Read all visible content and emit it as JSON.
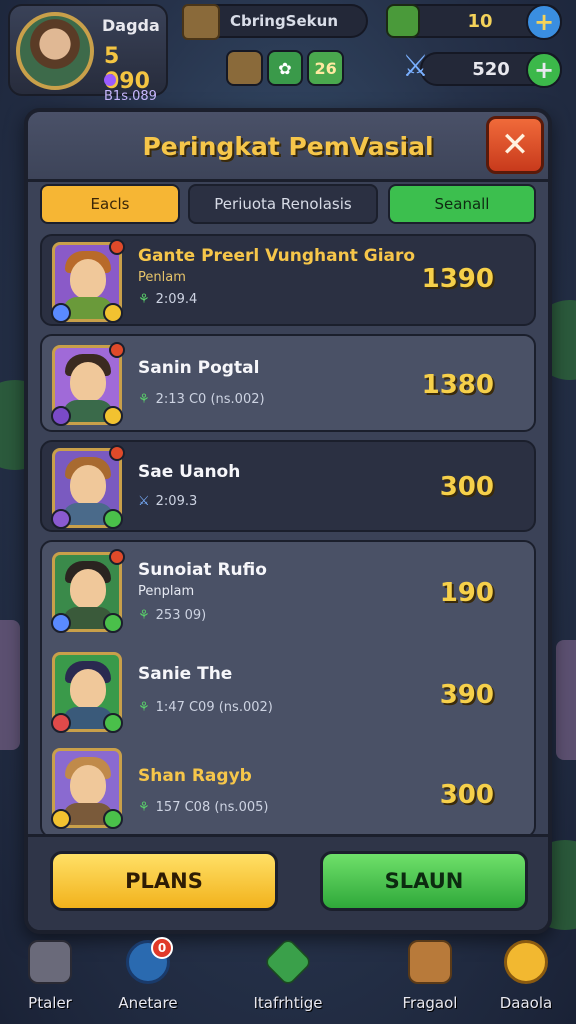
{
  "header": {
    "player_name": "Dagda",
    "gold": "5 090",
    "gems": "B1s.089",
    "chest_label": "CbringSekun",
    "energy_value": "10",
    "power_value": "520",
    "mini_slots": [
      "",
      "",
      "26"
    ]
  },
  "panel": {
    "title": "Peringkat PemVasial",
    "close_glyph": "✕",
    "tabs": [
      {
        "label": "Eacls",
        "active": true
      },
      {
        "label": "Periuota Renolasis",
        "active": false
      },
      {
        "label": "Seanall",
        "active": false
      }
    ]
  },
  "leaderboard": [
    {
      "name": "Gante Preerl Vunghant Giaro",
      "subtitle": "Penlam",
      "meta": "2:09.4",
      "score": "1390"
    },
    {
      "name": "Sanin Pogtal",
      "subtitle": "",
      "meta": "2:13 C0  (ns.002)",
      "score": "1380"
    },
    {
      "name": "Sae Uanoh",
      "subtitle": "",
      "meta": "2:09.3",
      "score": "300"
    },
    {
      "name": "Sunoiat Rufio",
      "subtitle": "Penplam",
      "meta": "253 09)",
      "score": "190"
    },
    {
      "name": "Sanie The",
      "subtitle": "",
      "meta": "1:47 C09  (ns.002)",
      "score": "390"
    },
    {
      "name": "Shan Ragyb",
      "subtitle": "",
      "meta": "157 C08  (ns.005)",
      "score": "300"
    }
  ],
  "actions": {
    "primary": "PLANS",
    "secondary": "SLAUN"
  },
  "nav": [
    {
      "label": "Ptaler",
      "icon": "castle-icon",
      "badge": ""
    },
    {
      "label": "Anetare",
      "icon": "portal-icon",
      "badge": "0"
    },
    {
      "label": "Itafrhtige",
      "icon": "gem-icon",
      "badge": ""
    },
    {
      "label": "Fragaol",
      "icon": "book-icon",
      "badge": ""
    },
    {
      "label": "Daaola",
      "icon": "coin-icon",
      "badge": ""
    }
  ],
  "colors": {
    "accent_gold": "#f6c64a",
    "tab_active": "#f6b634",
    "tab_green": "#3cbf4e",
    "close_red": "#e04a2a"
  }
}
